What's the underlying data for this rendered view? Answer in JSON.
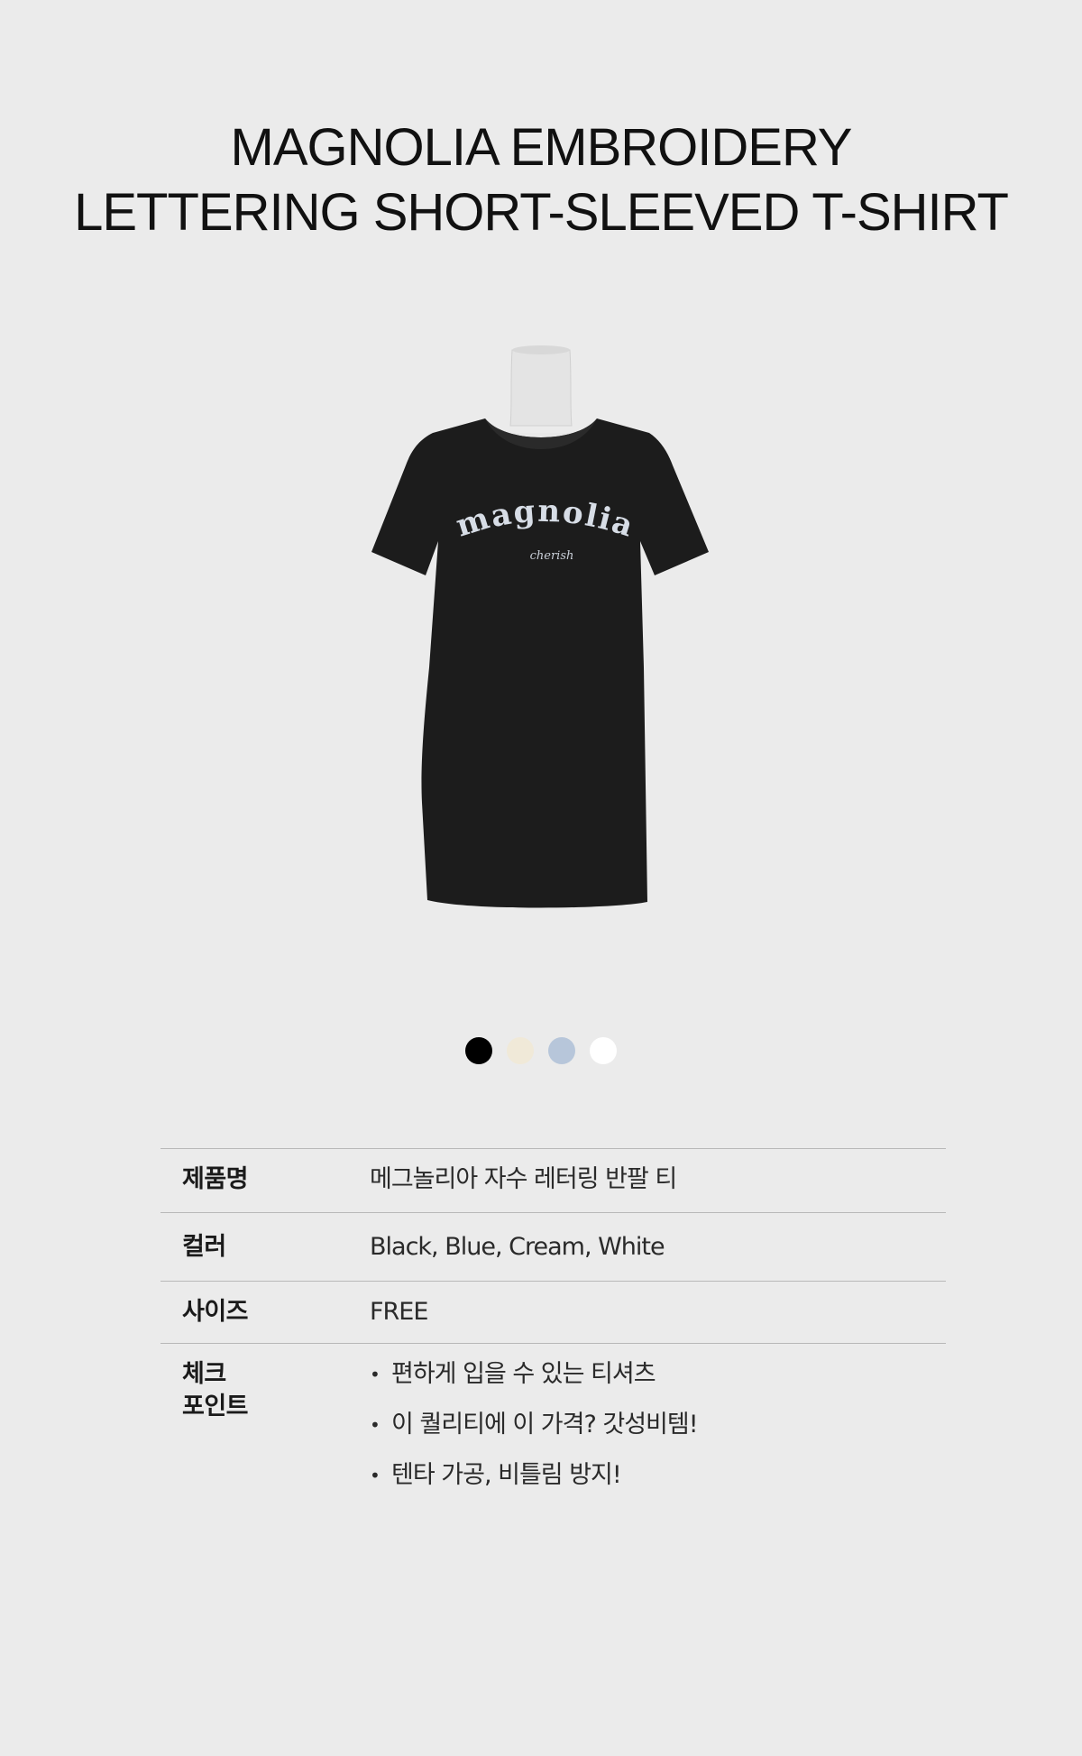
{
  "title": {
    "line1": "MAGNOLIA EMBROIDERY",
    "line2": "LETTERING SHORT-SLEEVED T-SHIRT"
  },
  "product_image": {
    "print_main": "magnolia",
    "print_sub": "cherish",
    "shirt_color": "#1c1c1c"
  },
  "swatches": [
    {
      "name": "Black",
      "color": "#000000"
    },
    {
      "name": "Cream",
      "color": "#f0e9d8"
    },
    {
      "name": "Blue",
      "color": "#b7c6da"
    },
    {
      "name": "White",
      "color": "#ffffff"
    }
  ],
  "info": {
    "name_label": "제품명",
    "name_value": "메그놀리아 자수 레터링 반팔 티",
    "color_label": "컬러",
    "color_value": "Black, Blue, Cream, White",
    "size_label": "사이즈",
    "size_value": "FREE",
    "points_label_1": "체크",
    "points_label_2": "포인트",
    "points": [
      "편하게 입을 수 있는 티셔츠",
      "이 퀄리티에 이 가격? 갓성비템!",
      "텐타 가공, 비틀림 방지!"
    ]
  }
}
